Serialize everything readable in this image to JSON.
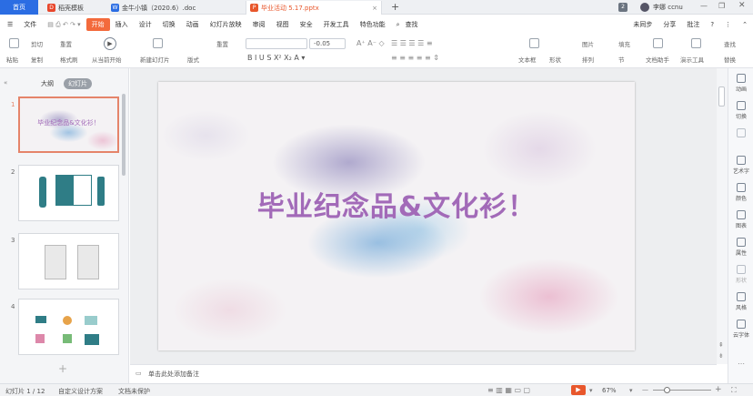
{
  "tabs": {
    "home": "首页",
    "t1": "稻壳模板",
    "t2": "金牛小镇（2020.6）.doc",
    "t3": "毕业活动 5.17.pptx",
    "add": "+",
    "badge": "2",
    "user": "李娜 ccnu"
  },
  "menu": {
    "file": "文件",
    "items": [
      "开始",
      "插入",
      "设计",
      "切换",
      "动画",
      "幻灯片放映",
      "审阅",
      "视图",
      "安全",
      "开发工具",
      "特色功能"
    ],
    "search": "查找",
    "sync": "未同步",
    "share": "分享",
    "batch": "批注"
  },
  "toolbar": {
    "paste": "粘贴",
    "cut": "剪切",
    "copy": "复制",
    "format": "格式刷",
    "from_current": "从当前开始",
    "new_slide": "新建幻灯片",
    "layout": "版式",
    "reset": "重置",
    "font_size": "-0.05",
    "textbox": "文本框",
    "shape": "形状",
    "arrange": "排列",
    "image": "图片",
    "fill": "填充",
    "wenzhu": "文档助手",
    "present_tools": "演示工具",
    "find": "查找",
    "replace": "替换",
    "section": "节"
  },
  "panel": {
    "outline": "大纲",
    "slides": "幻灯片"
  },
  "thumbs": [
    {
      "num": "1",
      "text": "毕业纪念品&文化衫！"
    },
    {
      "num": "2"
    },
    {
      "num": "3"
    },
    {
      "num": "4"
    }
  ],
  "slide": {
    "title": "毕业纪念品&文化衫！"
  },
  "notes": "单击此处添加备注",
  "rightbar": [
    "动画",
    "切换",
    "",
    "艺术字",
    "颜色",
    "图表",
    "属性",
    "形状",
    "风格",
    "云字体"
  ],
  "status": {
    "page": "幻灯片 1 / 12",
    "design": "自定义设计方案",
    "protect": "文档未保护",
    "zoom": "67%"
  },
  "colors": {
    "accent": "#2b6de3",
    "start": "#f36a3c",
    "title": "#a26ab8",
    "play": "#e8572c"
  }
}
